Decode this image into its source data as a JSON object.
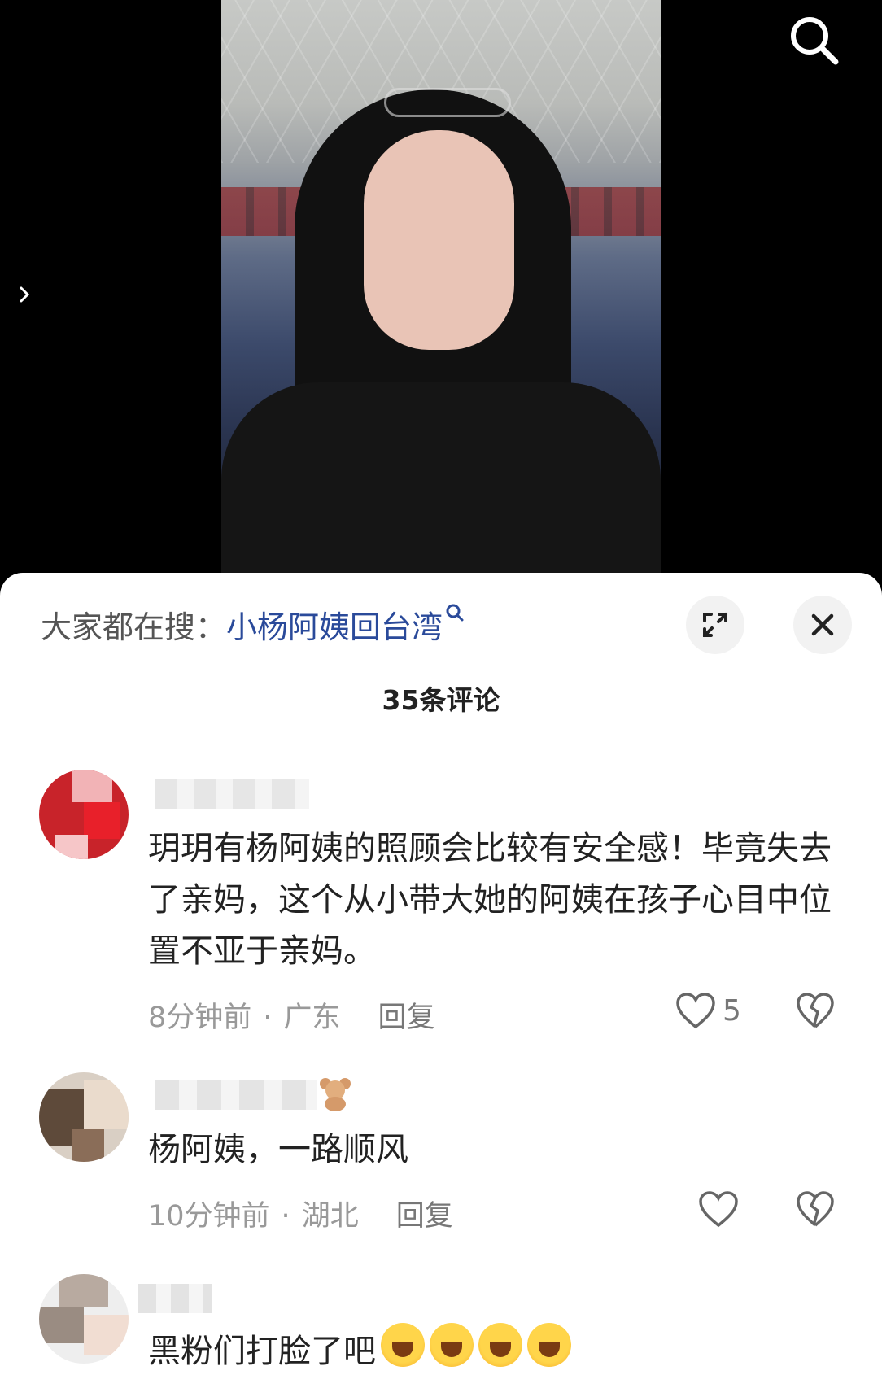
{
  "hot_search": {
    "prefix": "大家都在搜：",
    "query": "小杨阿姨回台湾",
    "query_icon": "magnifier-small-icon"
  },
  "header": {
    "comment_count": "35条评论"
  },
  "comments": [
    {
      "text": "玥玥有杨阿姨的照顾会比较有安全感！毕竟失去了亲妈，这个从小带大她的阿姨在孩子心目中位置不亚于亲妈。",
      "time": "8分钟前",
      "location": "广东",
      "reply_label": "回复",
      "like_count": "5"
    },
    {
      "text": "杨阿姨，一路顺风",
      "time": "10分钟前",
      "location": "湖北",
      "reply_label": "回复",
      "like_count": ""
    },
    {
      "text": "黑粉们打脸了吧",
      "emoji_count": 4
    }
  ],
  "meta_separator": "·",
  "colors": {
    "query_link": "#2a4a9a",
    "meta_gray": "#999999",
    "sheet_bg": "#ffffff"
  }
}
